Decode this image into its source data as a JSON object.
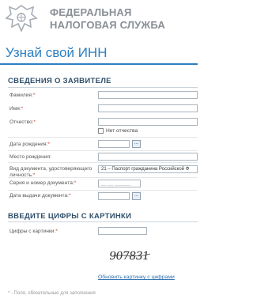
{
  "header": {
    "org_line1": "ФЕДЕРАЛЬНАЯ",
    "org_line2": "НАЛОГОВАЯ СЛУЖБА",
    "emblem_icon": "eagle-emblem-icon"
  },
  "page": {
    "title": "Узнай свой ИНН"
  },
  "applicant": {
    "heading": "СВЕДЕНИЯ О ЗАЯВИТЕЛЕ",
    "surname_label": "Фамилия:",
    "name_label": "Имя:",
    "patronymic_label": "Отчество:",
    "no_patronymic_label": "Нет отчества",
    "birthdate_label": "Дата рождения:",
    "birthplace_label": "Место рождения:",
    "doctype_label": "Вид документа, удостоверяющего личность:",
    "doctype_value": "21 – Паспорт гражданина Российской Ф",
    "docnumber_label": "Серия и номер документа:",
    "docnumber_placeholder": "__ __ ______",
    "issuedate_label": "Дата выдачи документа:",
    "calendar_button": "..."
  },
  "captcha_section": {
    "heading": "ВВЕДИТЕ ЦИФРЫ С КАРТИНКИ",
    "input_label": "Цифры с картинки:",
    "captcha_text": "907831",
    "refresh_link": "Обновить картинку с цифрами"
  },
  "footer": {
    "note": "* - Поля, обязательные для заполнения"
  },
  "colors": {
    "accent": "#2d7fc1",
    "required": "#d43a2f",
    "org_text": "#8a8f95"
  }
}
